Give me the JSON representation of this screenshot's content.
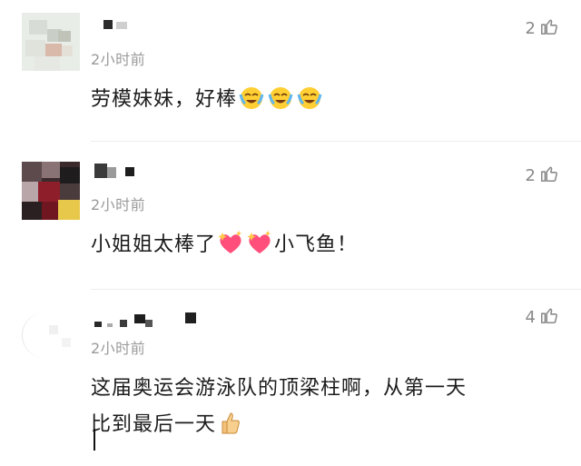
{
  "comments": [
    {
      "time": "2小时前",
      "likes": "2",
      "text_parts": [
        "劳模妹妹，好棒"
      ],
      "emojis": [
        "crying-laugh-emoji",
        "crying-laugh-emoji",
        "crying-laugh-emoji"
      ]
    },
    {
      "time": "2小时前",
      "likes": "2",
      "text_parts": [
        "小姐姐太棒了",
        "小飞鱼！"
      ],
      "emojis": [
        "sparkle-heart-emoji",
        "sparkle-heart-emoji"
      ]
    },
    {
      "time": "2小时前",
      "likes": "4",
      "text_line1": "这届奥运会游泳队的顶梁柱啊，从第一天",
      "text_line2": "比到最后一天",
      "emojis": [
        "thumbs-up-emoji"
      ]
    }
  ],
  "colors": {
    "text": "#1b1b1b",
    "muted": "#9a9a9a",
    "divider": "#ececec"
  }
}
